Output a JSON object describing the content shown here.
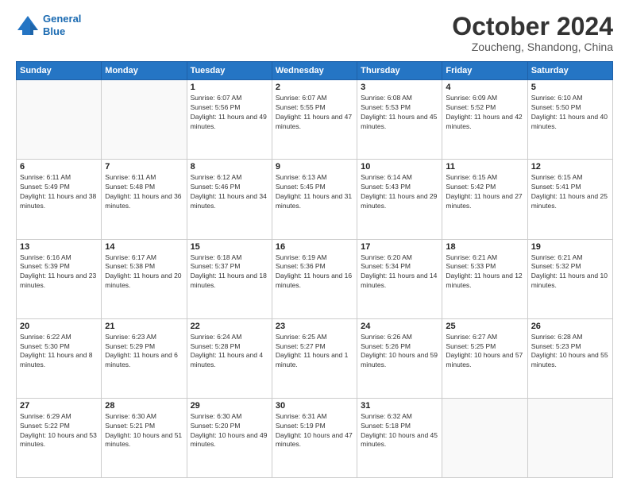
{
  "logo": {
    "line1": "General",
    "line2": "Blue"
  },
  "header": {
    "month": "October 2024",
    "location": "Zoucheng, Shandong, China"
  },
  "days_of_week": [
    "Sunday",
    "Monday",
    "Tuesday",
    "Wednesday",
    "Thursday",
    "Friday",
    "Saturday"
  ],
  "weeks": [
    [
      {
        "day": "",
        "info": ""
      },
      {
        "day": "",
        "info": ""
      },
      {
        "day": "1",
        "info": "Sunrise: 6:07 AM\nSunset: 5:56 PM\nDaylight: 11 hours and 49 minutes."
      },
      {
        "day": "2",
        "info": "Sunrise: 6:07 AM\nSunset: 5:55 PM\nDaylight: 11 hours and 47 minutes."
      },
      {
        "day": "3",
        "info": "Sunrise: 6:08 AM\nSunset: 5:53 PM\nDaylight: 11 hours and 45 minutes."
      },
      {
        "day": "4",
        "info": "Sunrise: 6:09 AM\nSunset: 5:52 PM\nDaylight: 11 hours and 42 minutes."
      },
      {
        "day": "5",
        "info": "Sunrise: 6:10 AM\nSunset: 5:50 PM\nDaylight: 11 hours and 40 minutes."
      }
    ],
    [
      {
        "day": "6",
        "info": "Sunrise: 6:11 AM\nSunset: 5:49 PM\nDaylight: 11 hours and 38 minutes."
      },
      {
        "day": "7",
        "info": "Sunrise: 6:11 AM\nSunset: 5:48 PM\nDaylight: 11 hours and 36 minutes."
      },
      {
        "day": "8",
        "info": "Sunrise: 6:12 AM\nSunset: 5:46 PM\nDaylight: 11 hours and 34 minutes."
      },
      {
        "day": "9",
        "info": "Sunrise: 6:13 AM\nSunset: 5:45 PM\nDaylight: 11 hours and 31 minutes."
      },
      {
        "day": "10",
        "info": "Sunrise: 6:14 AM\nSunset: 5:43 PM\nDaylight: 11 hours and 29 minutes."
      },
      {
        "day": "11",
        "info": "Sunrise: 6:15 AM\nSunset: 5:42 PM\nDaylight: 11 hours and 27 minutes."
      },
      {
        "day": "12",
        "info": "Sunrise: 6:15 AM\nSunset: 5:41 PM\nDaylight: 11 hours and 25 minutes."
      }
    ],
    [
      {
        "day": "13",
        "info": "Sunrise: 6:16 AM\nSunset: 5:39 PM\nDaylight: 11 hours and 23 minutes."
      },
      {
        "day": "14",
        "info": "Sunrise: 6:17 AM\nSunset: 5:38 PM\nDaylight: 11 hours and 20 minutes."
      },
      {
        "day": "15",
        "info": "Sunrise: 6:18 AM\nSunset: 5:37 PM\nDaylight: 11 hours and 18 minutes."
      },
      {
        "day": "16",
        "info": "Sunrise: 6:19 AM\nSunset: 5:36 PM\nDaylight: 11 hours and 16 minutes."
      },
      {
        "day": "17",
        "info": "Sunrise: 6:20 AM\nSunset: 5:34 PM\nDaylight: 11 hours and 14 minutes."
      },
      {
        "day": "18",
        "info": "Sunrise: 6:21 AM\nSunset: 5:33 PM\nDaylight: 11 hours and 12 minutes."
      },
      {
        "day": "19",
        "info": "Sunrise: 6:21 AM\nSunset: 5:32 PM\nDaylight: 11 hours and 10 minutes."
      }
    ],
    [
      {
        "day": "20",
        "info": "Sunrise: 6:22 AM\nSunset: 5:30 PM\nDaylight: 11 hours and 8 minutes."
      },
      {
        "day": "21",
        "info": "Sunrise: 6:23 AM\nSunset: 5:29 PM\nDaylight: 11 hours and 6 minutes."
      },
      {
        "day": "22",
        "info": "Sunrise: 6:24 AM\nSunset: 5:28 PM\nDaylight: 11 hours and 4 minutes."
      },
      {
        "day": "23",
        "info": "Sunrise: 6:25 AM\nSunset: 5:27 PM\nDaylight: 11 hours and 1 minute."
      },
      {
        "day": "24",
        "info": "Sunrise: 6:26 AM\nSunset: 5:26 PM\nDaylight: 10 hours and 59 minutes."
      },
      {
        "day": "25",
        "info": "Sunrise: 6:27 AM\nSunset: 5:25 PM\nDaylight: 10 hours and 57 minutes."
      },
      {
        "day": "26",
        "info": "Sunrise: 6:28 AM\nSunset: 5:23 PM\nDaylight: 10 hours and 55 minutes."
      }
    ],
    [
      {
        "day": "27",
        "info": "Sunrise: 6:29 AM\nSunset: 5:22 PM\nDaylight: 10 hours and 53 minutes."
      },
      {
        "day": "28",
        "info": "Sunrise: 6:30 AM\nSunset: 5:21 PM\nDaylight: 10 hours and 51 minutes."
      },
      {
        "day": "29",
        "info": "Sunrise: 6:30 AM\nSunset: 5:20 PM\nDaylight: 10 hours and 49 minutes."
      },
      {
        "day": "30",
        "info": "Sunrise: 6:31 AM\nSunset: 5:19 PM\nDaylight: 10 hours and 47 minutes."
      },
      {
        "day": "31",
        "info": "Sunrise: 6:32 AM\nSunset: 5:18 PM\nDaylight: 10 hours and 45 minutes."
      },
      {
        "day": "",
        "info": ""
      },
      {
        "day": "",
        "info": ""
      }
    ]
  ]
}
